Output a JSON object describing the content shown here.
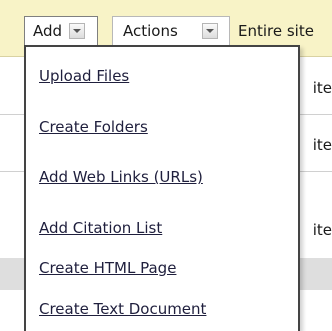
{
  "toolbar": {
    "add_label": "Add",
    "actions_label": "Actions",
    "scope_text": "Entire site"
  },
  "background_rows": [
    {
      "text": "ite"
    },
    {
      "text": "ite"
    },
    {
      "text": "ite"
    }
  ],
  "add_menu": {
    "items": [
      {
        "label": "Upload Files"
      },
      {
        "label": "Create Folders"
      },
      {
        "label": "Add Web Links (URLs)"
      },
      {
        "label": "Add Citation List"
      },
      {
        "label": "Create HTML Page"
      },
      {
        "label": "Create Text Document"
      }
    ]
  },
  "icons": {
    "add_dropdown": "chevron-down-icon",
    "actions_dropdown": "chevron-down-icon"
  }
}
